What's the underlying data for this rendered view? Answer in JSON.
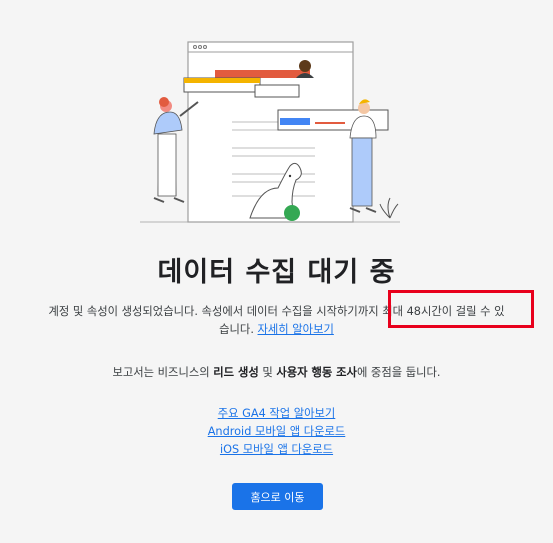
{
  "title": "데이터 수집 대기 중",
  "description": {
    "line1": "계정 및 속성이 생성되었습니다. 속성에서 데이터 수집을 시작하기까지 최대 48시간이 걸릴 수 있",
    "line2_prefix": "습니다. ",
    "learn_more": "자세히 알아보기"
  },
  "focus": {
    "prefix": "보고서는 비즈니스의 ",
    "lead": "리드 생성",
    "middle": " 및 ",
    "behavior": "사용자 행동 조사",
    "suffix": "에 중점을 둡니다."
  },
  "links": [
    {
      "label": "주요 GA4 작업 알아보기"
    },
    {
      "label": "Android 모바일 앱 다운로드"
    },
    {
      "label": "iOS 모바일 앱 다운로드"
    }
  ],
  "button": {
    "label": "홈으로 이동"
  },
  "colors": {
    "accent": "#1a73e8",
    "highlight": "#e8001c"
  }
}
